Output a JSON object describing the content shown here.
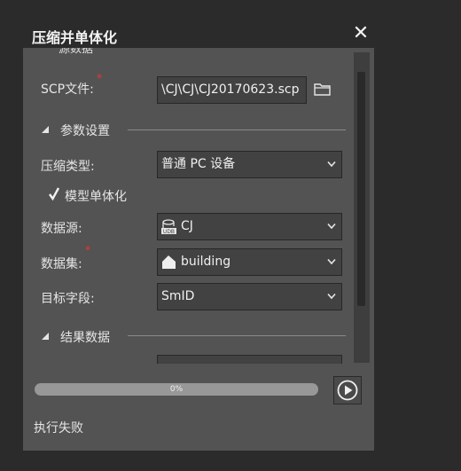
{
  "dialog": {
    "title": "压缩并单体化",
    "close_icon": "close-icon"
  },
  "source_section": {
    "label": "源数据"
  },
  "scp_file": {
    "label": "SCP文件:",
    "value": "\\CJ\\CJ\\CJ20170623.scp",
    "required": true,
    "browse_icon": "folder-icon"
  },
  "params_section": {
    "label": "参数设置"
  },
  "compression_type": {
    "label": "压缩类型:",
    "value": "普通 PC 设备"
  },
  "model_singlize": {
    "label": "模型单体化",
    "checked": true
  },
  "datasource": {
    "label": "数据源:",
    "value": "CJ",
    "icon": "udb-datasource-icon"
  },
  "dataset": {
    "label": "数据集:",
    "value": "building",
    "icon": "region-dataset-icon",
    "required": true
  },
  "target_field": {
    "label": "目标字段:",
    "value": "SmID"
  },
  "result_section": {
    "label": "结果数据"
  },
  "progress": {
    "value": 0,
    "text": "0%"
  },
  "status": {
    "text": "执行失败"
  },
  "colors": {
    "required": "#ee3333",
    "panel": "#535353",
    "field": "#424242"
  }
}
